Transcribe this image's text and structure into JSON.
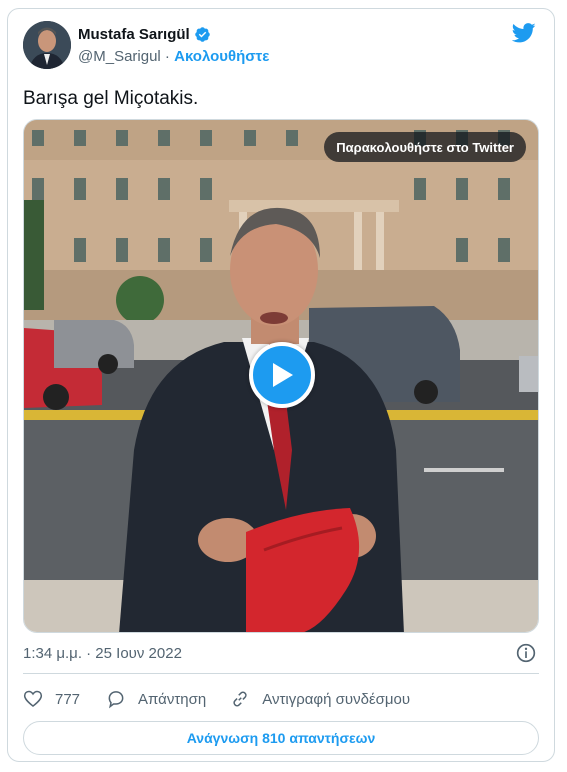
{
  "tweet": {
    "author_name": "Mustafa Sarıgül",
    "handle": "@M_Sarigul",
    "separator": " · ",
    "follow_label": "Ακολουθήστε",
    "text": "Barışa gel Miçotakis.",
    "watch_on_twitter_label": "Παρακολουθήστε στο Twitter",
    "timestamp": "1:34 μ.μ. · 25 Ιουν 2022",
    "like_count": "777",
    "reply_label": "Απάντηση",
    "copy_link_label": "Αντιγραφή συνδέσμου",
    "read_replies_label": "Ανάγνωση 810 απαντήσεων"
  },
  "icons": {
    "brand": "twitter-bird-icon",
    "verified": "verified-badge-icon",
    "info": "info-icon",
    "like": "heart-icon",
    "reply": "reply-bubble-icon",
    "copy": "link-icon",
    "play": "play-icon"
  },
  "colors": {
    "accent": "#1d9bf0",
    "text_primary": "#0f1419",
    "text_secondary": "#536471",
    "border": "#cfd9de"
  }
}
